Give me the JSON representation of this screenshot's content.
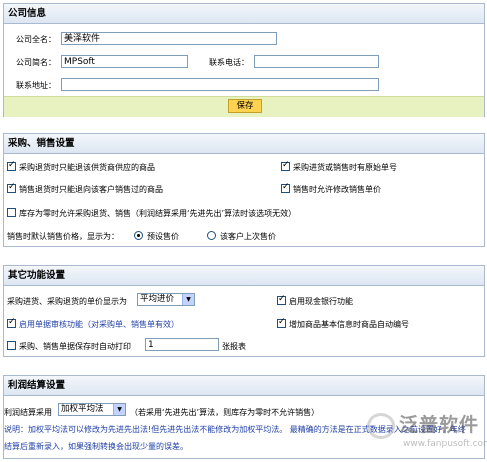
{
  "company": {
    "title": "公司信息",
    "fullname_label": "公司全名：",
    "fullname_value": "美泽软件",
    "shortname_label": "公司简名：",
    "shortname_value": "MPSoft",
    "phone_label": "联系电话：",
    "phone_value": "",
    "address_label": "联系地址：",
    "address_value": "",
    "save_label": "保存"
  },
  "purchase": {
    "title": "采购、销售设置",
    "opt1": "采购退货时只能退该供货商供应的商品",
    "opt2": "采购进货或销售时有原始单号",
    "opt3": "销售退货时只能退向该客户销售过的商品",
    "opt4": "销售时允许修改销售单价",
    "opt5": "库存为零时允许采购退货、销售（利润结算采用‘先进先出’算法时该选项无效）",
    "price_label": "销售时默认销售价格，显示为：",
    "radio1": "预设售价",
    "radio2": "该客户上次售价"
  },
  "other": {
    "title": "其它功能设置",
    "price_display_label": "采购进货、采购退货的单价显示为",
    "price_display_value": "平均进价",
    "cash_bank": "启用现金银行功能",
    "audit": "启用单据审核功能（对采购单、销售单有效）",
    "auto_code": "增加商品基本信息时商品自动编号",
    "auto_print_label": "采购、销售单据保存时自动打印",
    "auto_print_value": "1",
    "auto_print_unit": "张报表"
  },
  "profit": {
    "title": "利润结算设置",
    "method_label": "利润结算采用",
    "method_value": "加权平均法",
    "method_note": "（若采用‘先进先出’算法，则库存为零时不允许销售）",
    "note_line1": "说明：加权平均法可以修改为先进先出法!但先进先出法不能修改为加权平均法。 最精确的方法是在正式数据录入之前设置好，年终",
    "note_line2": "结算后重新录入，如果强制转换会出现少量的误差。"
  },
  "watermark": {
    "brand": "泛普软件",
    "url": "www.fanpusoft.com"
  }
}
